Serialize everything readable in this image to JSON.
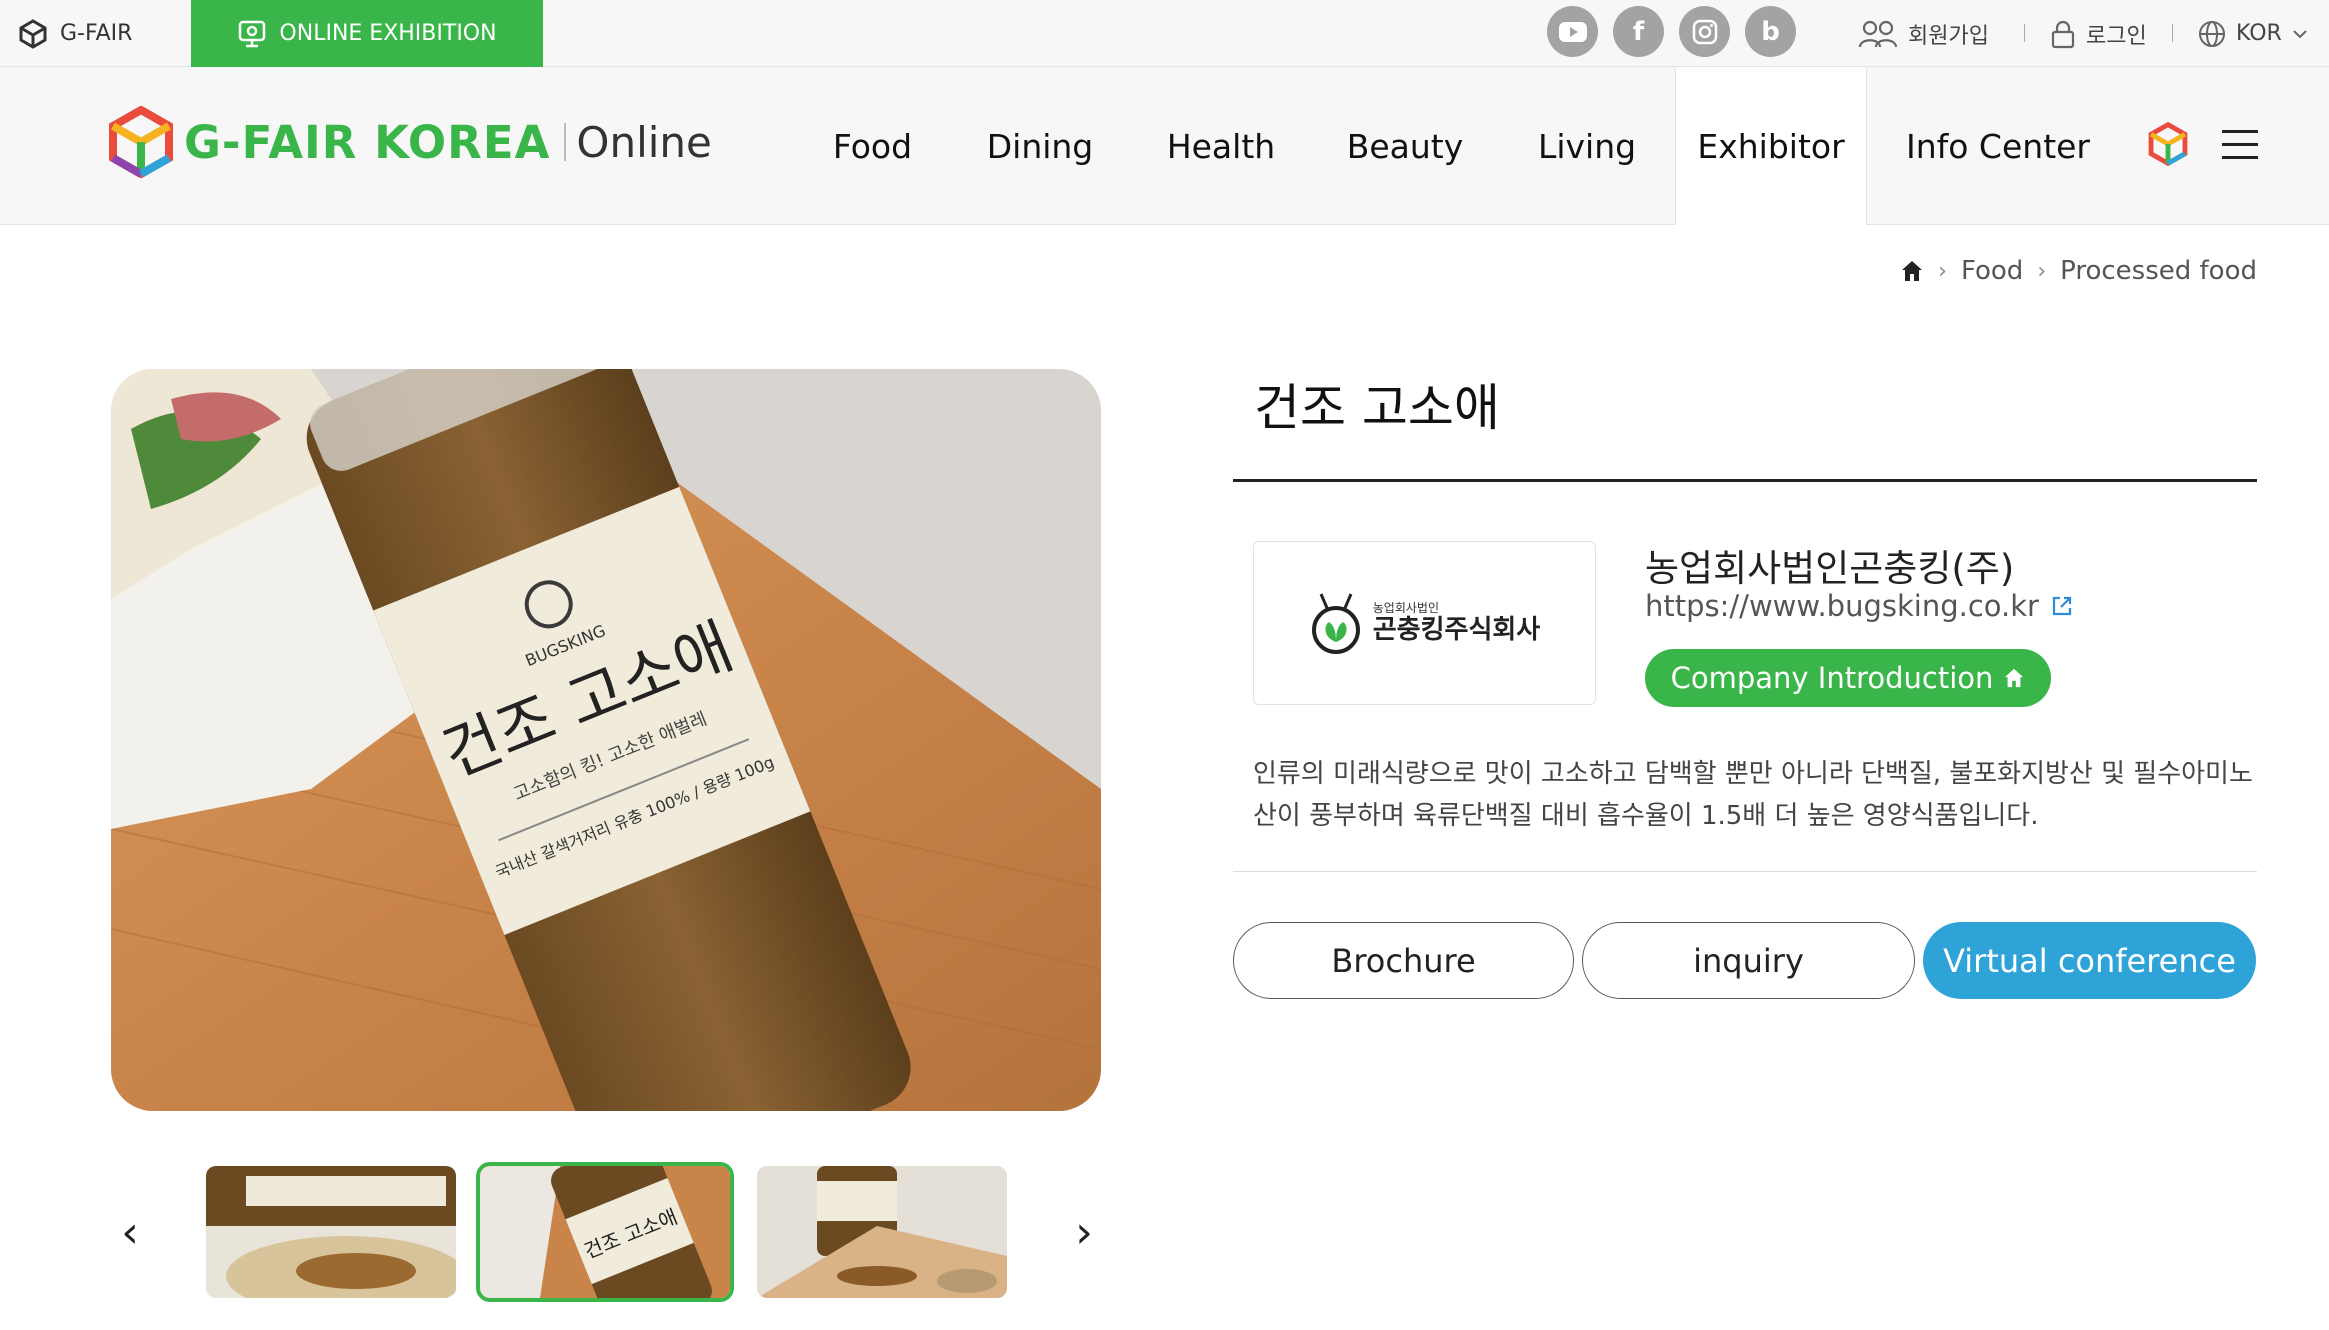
{
  "topbar": {
    "gfair_label": "G-FAIR",
    "online_label": "ONLINE EXHIBITION",
    "socials": [
      {
        "name": "youtube",
        "glyph": "▶"
      },
      {
        "name": "facebook",
        "glyph": "f"
      },
      {
        "name": "instagram",
        "glyph": "◎"
      },
      {
        "name": "blog",
        "glyph": "b"
      }
    ],
    "signup_label": "회원가입",
    "login_label": "로그인",
    "lang_label": "KOR"
  },
  "header": {
    "logo_text": "G-FAIR KOREA",
    "logo_sub": "Online",
    "nav": [
      "Food",
      "Dining",
      "Health",
      "Beauty",
      "Living",
      "Exhibitor",
      "Info Center"
    ],
    "active_nav": "Exhibitor"
  },
  "breadcrumb": {
    "items": [
      "Food",
      "Processed food"
    ]
  },
  "product": {
    "title": "건조 고소애",
    "company_logo_small": "농업회사법인",
    "company_logo_big": "곤충킹주식회사",
    "company_name": "농업회사법인곤충킹(주)",
    "company_url": "https://www.bugsking.co.kr",
    "company_intro_label": "Company Introduction",
    "description": "인류의 미래식량으로 맛이 고소하고 담백할 뿐만 아니라 단백질, 불포화지방산 및 필수아미노산이 풍부하며 육류단백질 대비 흡수율이 1.5배 더 높은 영양식품입니다.",
    "buttons": {
      "brochure": "Brochure",
      "inquiry": "inquiry",
      "virtual": "Virtual conference"
    }
  },
  "gallery": {
    "jar_title": "건조 고소애",
    "jar_brand": "BUGSKING",
    "jar_tagline": "고소함의 킹! 고소한 애벌레",
    "jar_spec": "국내산 갈색거저리 유충 100% / 용량 100g",
    "thumbnail_count": 3,
    "active_thumbnail": 2
  },
  "colors": {
    "brand_green": "#3ab54a",
    "accent_blue": "#2ea3d8"
  }
}
